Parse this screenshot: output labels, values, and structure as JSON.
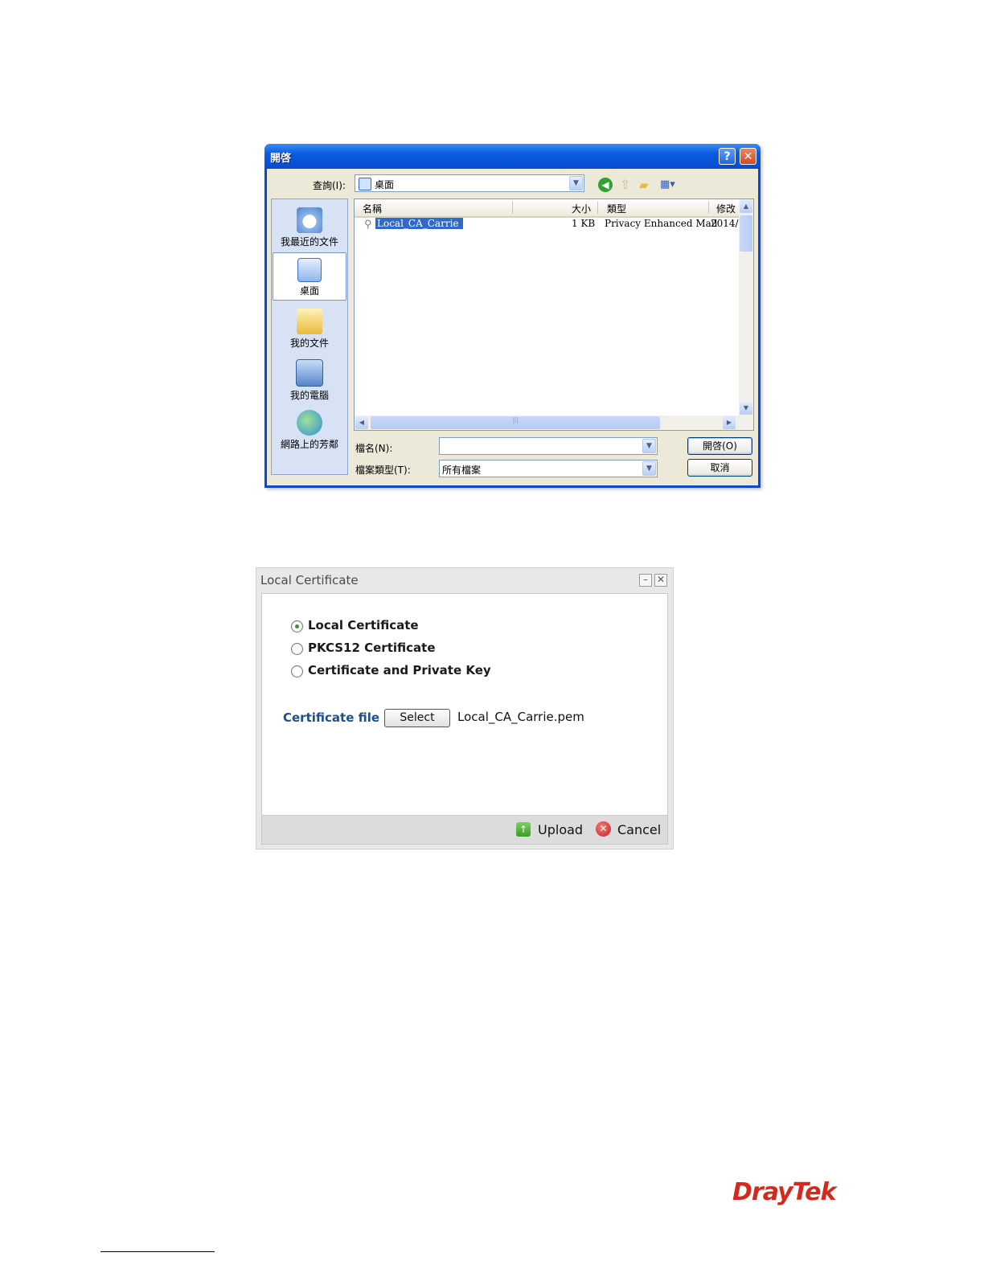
{
  "file_dialog": {
    "title": "開啓",
    "help_label": "?",
    "close_label": "✕",
    "look_in_label": "查詢(I):",
    "look_in_value": "桌面",
    "places": [
      {
        "label": "我最近的文件",
        "icon": "recent-documents-icon"
      },
      {
        "label": "桌面",
        "icon": "desktop-icon"
      },
      {
        "label": "我的文件",
        "icon": "my-documents-icon"
      },
      {
        "label": "我的電腦",
        "icon": "my-computer-icon"
      },
      {
        "label": "網路上的芳鄰",
        "icon": "network-places-icon"
      }
    ],
    "columns": {
      "name": "名稱",
      "size": "大小",
      "type": "類型",
      "modified": "修改"
    },
    "files": [
      {
        "name": "Local_CA_Carrie",
        "size": "1 KB",
        "type": "Privacy Enhanced Mail",
        "modified": "2014/"
      }
    ],
    "filename_label": "檔名(N):",
    "filename_value": "",
    "filetype_label": "檔案類型(T):",
    "filetype_value": "所有檔案",
    "open_button": "開啓(O)",
    "cancel_button": "取消"
  },
  "local_certificate": {
    "title": "Local Certificate",
    "options": [
      {
        "label": "Local Certificate",
        "checked": true
      },
      {
        "label": "PKCS12 Certificate",
        "checked": false
      },
      {
        "label": "Certificate and Private Key",
        "checked": false
      }
    ],
    "cert_file_label": "Certificate file :",
    "select_button": "Select",
    "cert_file_value": "Local_CA_Carrie.pem",
    "upload_button": "Upload",
    "cancel_button": "Cancel"
  },
  "brand": {
    "text": "DrayTek",
    "color": "#d42a1e"
  }
}
